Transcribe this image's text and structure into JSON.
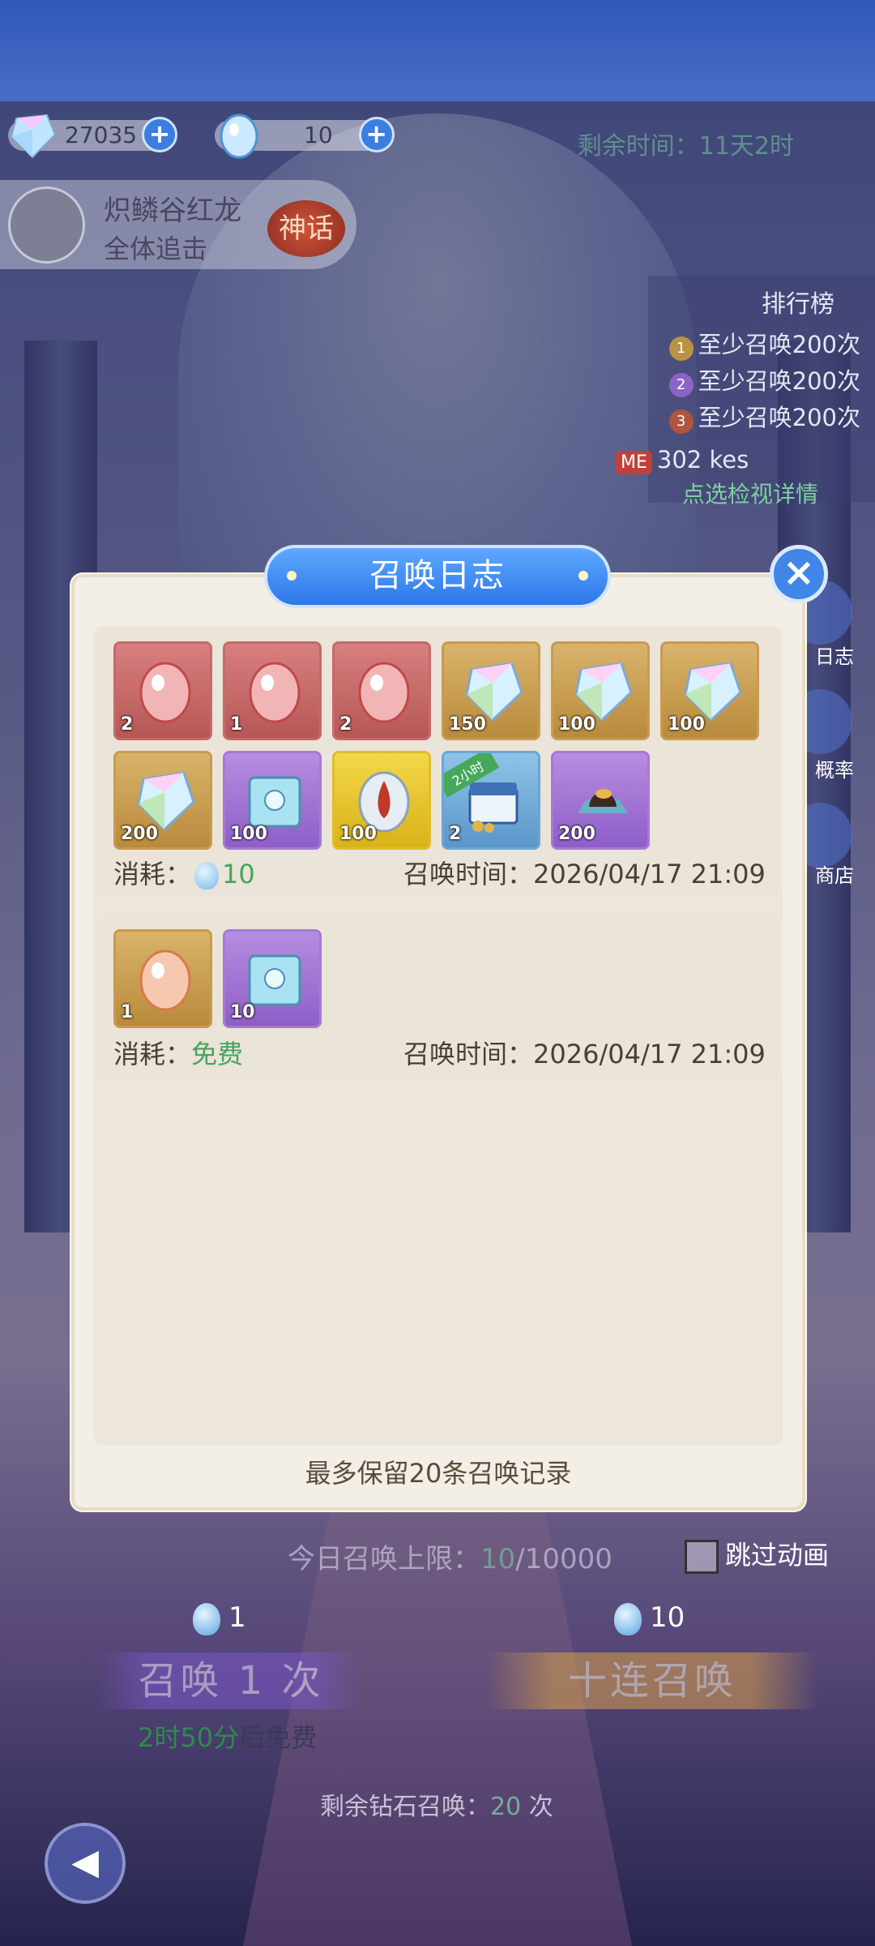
{
  "resources": {
    "diamonds": "27035",
    "eggs": "10"
  },
  "event": {
    "remaining_time_label": "剩余时间：",
    "remaining_time_value": "11天2时"
  },
  "boss": {
    "name": "炽鳞谷红龙",
    "subtitle": "全体追击",
    "rarity": "神话"
  },
  "ranking": {
    "title": "排行榜",
    "rows": [
      "至少召唤200次",
      "至少召唤200次",
      "至少召唤200次"
    ],
    "me_badge": "ME",
    "me_value": "302",
    "me_unit": "kes",
    "detail_link": "点选检视详情"
  },
  "side_menu": {
    "log": "日志",
    "rate": "概率",
    "shop": "商店"
  },
  "modal": {
    "title": "召唤日志",
    "close_icon": "close-icon",
    "records": [
      {
        "items": [
          {
            "icon": "red-egg",
            "qty": "2"
          },
          {
            "icon": "red-egg",
            "qty": "1"
          },
          {
            "icon": "red-egg",
            "qty": "2"
          },
          {
            "icon": "rainbow-diamond",
            "qty": "150"
          },
          {
            "icon": "rainbow-diamond",
            "qty": "100"
          },
          {
            "icon": "rainbow-diamond",
            "qty": "100"
          },
          {
            "icon": "rainbow-diamond",
            "qty": "200"
          },
          {
            "icon": "skill-book",
            "qty": "100"
          },
          {
            "icon": "fire-egg",
            "qty": "100"
          },
          {
            "icon": "treasure-chest",
            "qty": "2",
            "tag": "2小时"
          },
          {
            "icon": "gold-ore",
            "qty": "200"
          }
        ],
        "cost_label": "消耗：",
        "cost_value": "10",
        "time_label": "召唤时间：",
        "time_value": "2026/04/17 21:09"
      },
      {
        "items": [
          {
            "icon": "orange-egg",
            "qty": "1"
          },
          {
            "icon": "skill-book",
            "qty": "10"
          }
        ],
        "cost_label": "消耗：",
        "cost_value": "免费",
        "time_label": "召唤时间：",
        "time_value": "2026/04/17 21:09"
      }
    ],
    "footer": "最多保留20条召唤记录"
  },
  "hud": {
    "limit_label": "今日召唤上限：",
    "limit_current": "10",
    "limit_max": "/10000",
    "skip_label": "跳过动画",
    "cost_single": "1",
    "cost_ten": "10",
    "summon_one": "召唤 1 次",
    "summon_ten": "十连召唤",
    "free_time": "2时50分",
    "free_suffix": "后免费",
    "remaining_label": "剩余钻石召唤：",
    "remaining_count": "20",
    "remaining_unit": "次"
  },
  "colors": {
    "accent_blue": "#3f86e8",
    "modal_bg": "#f4efe6",
    "cost_green": "#46a360"
  }
}
